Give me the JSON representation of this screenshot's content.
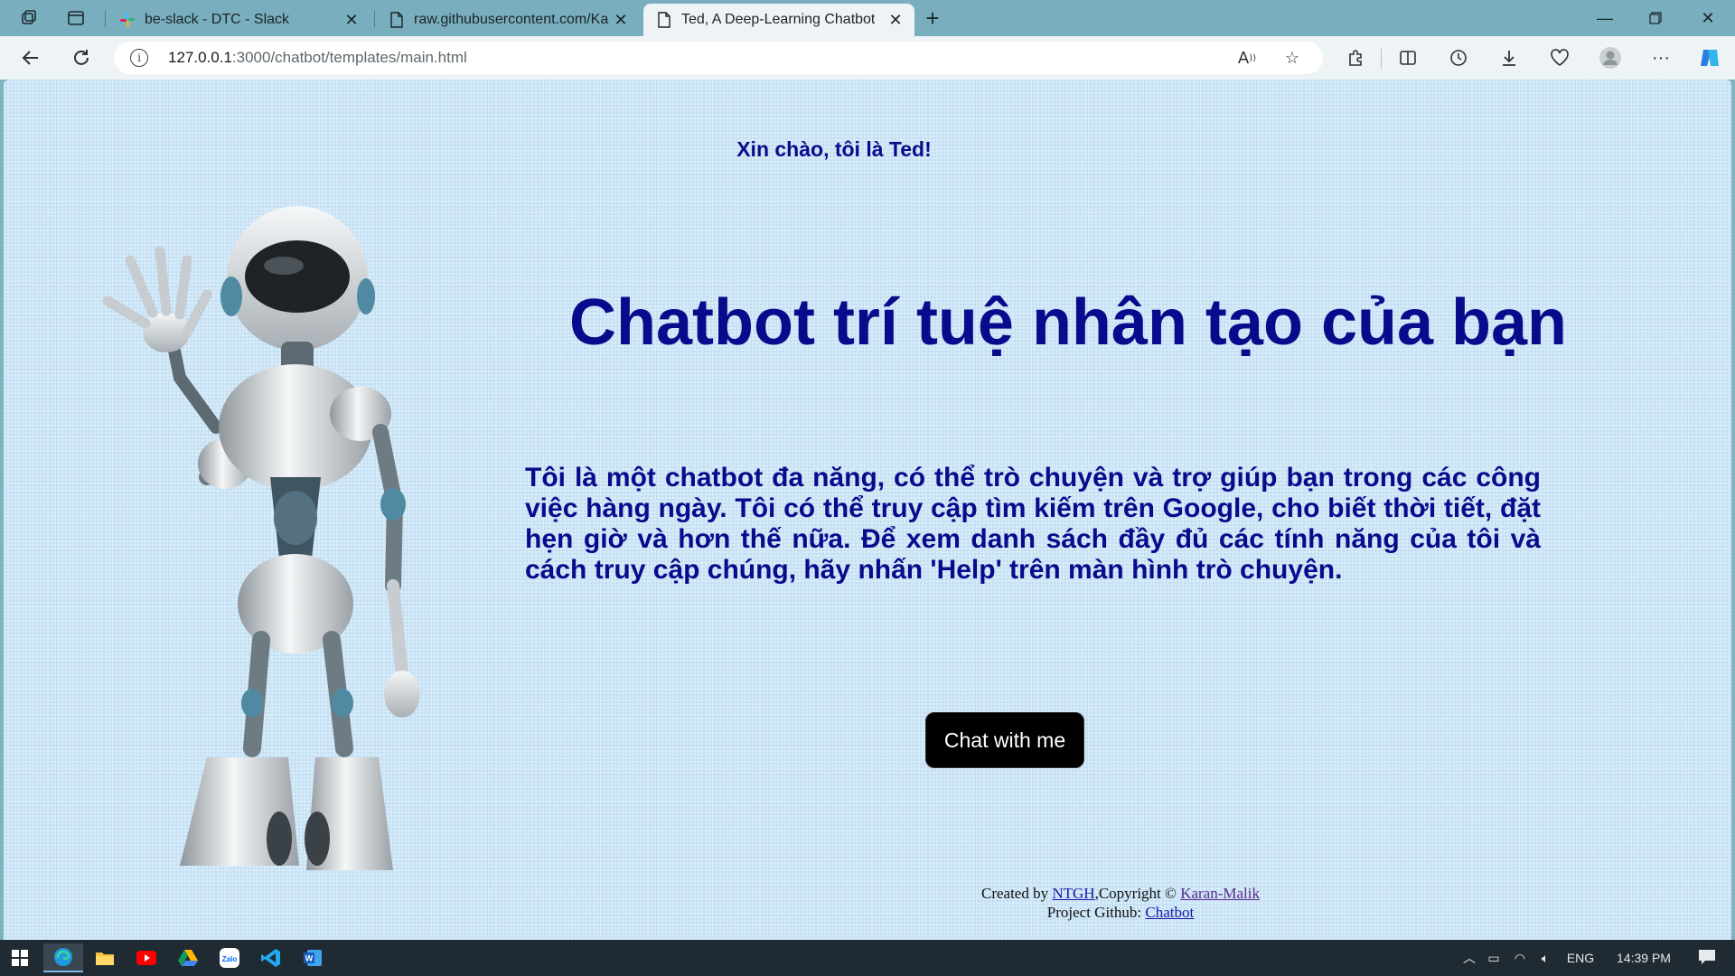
{
  "browser": {
    "tabs": [
      {
        "label": "be-slack - DTC - Slack",
        "icon": "slack-icon",
        "active": false
      },
      {
        "label": "raw.githubusercontent.com/Kara",
        "icon": "page-icon",
        "active": false
      },
      {
        "label": "Ted, A Deep-Learning Chatbot",
        "icon": "page-icon",
        "active": true
      }
    ],
    "url_host": "127.0.0.1",
    "url_path": ":3000/chatbot/templates/main.html"
  },
  "page": {
    "greeting": "Xin chào, tôi là Ted!",
    "headline": "Chatbot trí tuệ nhân tạo của bạn",
    "description": "Tôi là một chatbot đa năng, có thể trò chuyện và trợ giúp bạn trong các công việc hàng ngày. Tôi có thể truy cập tìm kiếm trên Google, cho biết thời tiết, đặt hẹn giờ và hơn thế nữa. Để xem danh sách đầy đủ các tính năng của tôi và cách truy cập chúng, hãy nhấn 'Help' trên màn hình trò chuyện.",
    "chat_button": "Chat with me",
    "footer": {
      "created_by_prefix": "Created by ",
      "author_link": "NTGH",
      "copyright_prefix": ",Copyright © ",
      "copyright_link": "Karan-Malik",
      "github_prefix": "Project Github: ",
      "github_link": "Chatbot"
    }
  },
  "taskbar": {
    "language": "ENG",
    "time": "14:39 PM"
  },
  "colors": {
    "heading": "#0a0a8c",
    "page_background": "#cfe8f8",
    "tabstrip": "#78aebd"
  }
}
